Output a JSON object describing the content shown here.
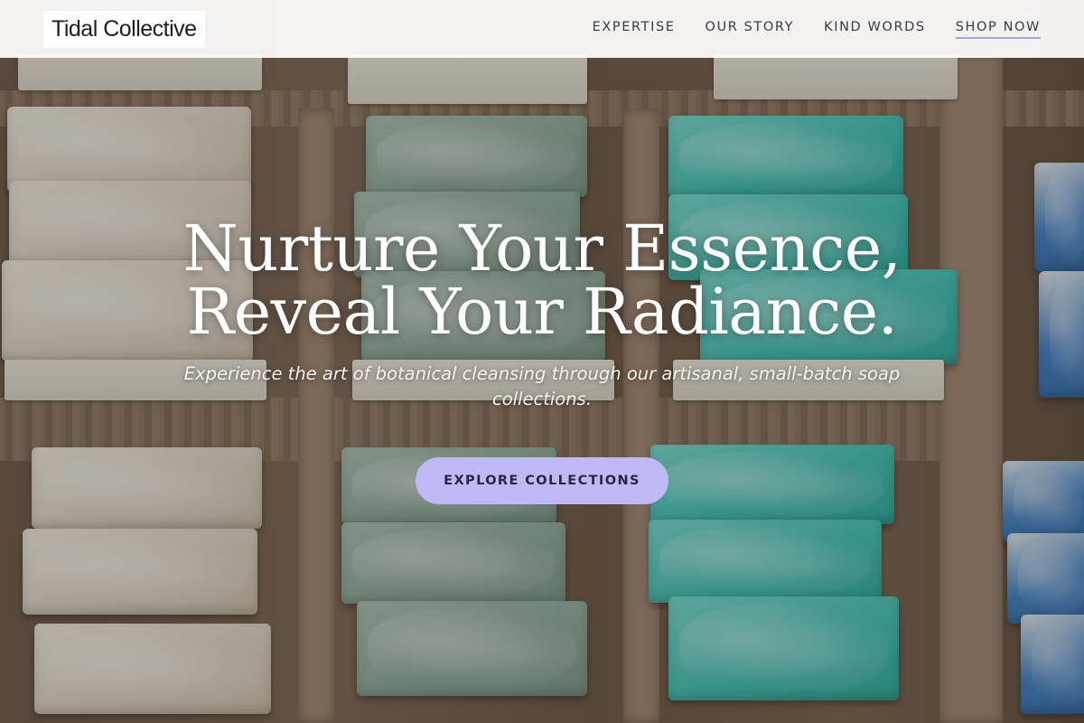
{
  "brand": {
    "name": "Tidal Collective"
  },
  "nav": {
    "items": [
      {
        "label": "EXPERTISE",
        "active": false
      },
      {
        "label": "OUR STORY",
        "active": false
      },
      {
        "label": "KIND WORDS",
        "active": false
      },
      {
        "label": "SHOP NOW",
        "active": true
      }
    ]
  },
  "hero": {
    "headline_line1": "Nurture Your Essence,",
    "headline_line2": "Reveal Your Radiance.",
    "subheadline": "Experience the art of botanical cleansing through our artisanal, small-batch soap collections.",
    "cta_label": "EXPLORE COLLECTIONS",
    "background": "handmade soap bars arranged in wooden crates"
  },
  "colors": {
    "accent": "#c1b8f7",
    "nav_underline": "#a9a0e6",
    "header_bg": "#ffffff",
    "headline_text": "#ffffff"
  }
}
